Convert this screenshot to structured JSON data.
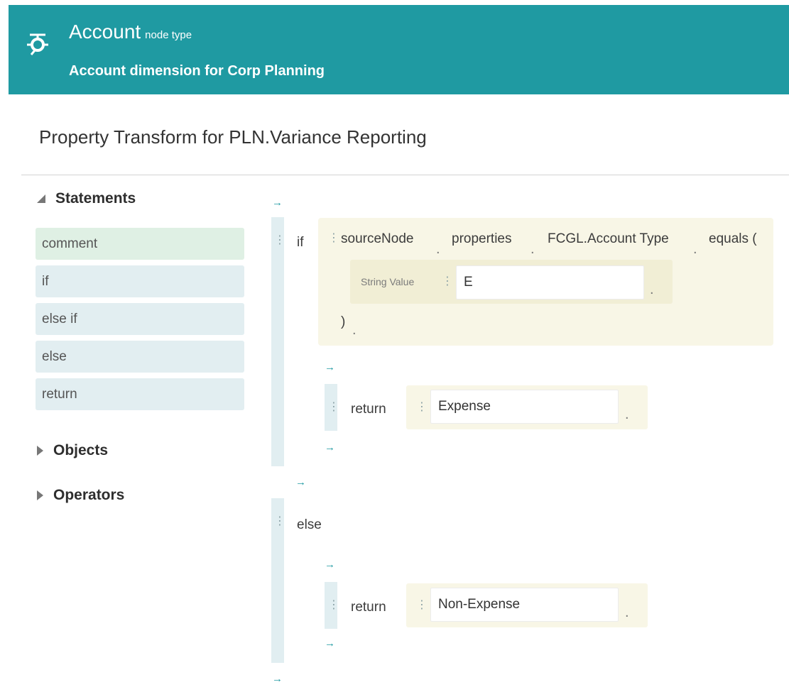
{
  "header": {
    "title": "Account",
    "node_type_label": "node type",
    "description": "Account dimension for Corp Planning",
    "icon": "node-type-icon",
    "background_color": "#1f9aa2"
  },
  "page_title": "Property Transform for PLN.Variance Reporting",
  "palette": {
    "statements_label": "Statements",
    "statements": [
      "comment",
      "if",
      "else if",
      "else",
      "return"
    ],
    "objects_label": "Objects",
    "operators_label": "Operators"
  },
  "editor": {
    "arrow": "→",
    "grip": "⋮",
    "dot": ".",
    "if_block": {
      "keyword": "if",
      "chain": {
        "object": "sourceNode",
        "member": "properties",
        "property": "FCGL.Account Type",
        "method": "equals ("
      },
      "argument_label": "String Value",
      "argument_value": "E",
      "close_paren": ")",
      "return_keyword": "return",
      "return_value": "Expense"
    },
    "else_block": {
      "keyword": "else",
      "return_keyword": "return",
      "return_value": "Non-Expense"
    }
  }
}
